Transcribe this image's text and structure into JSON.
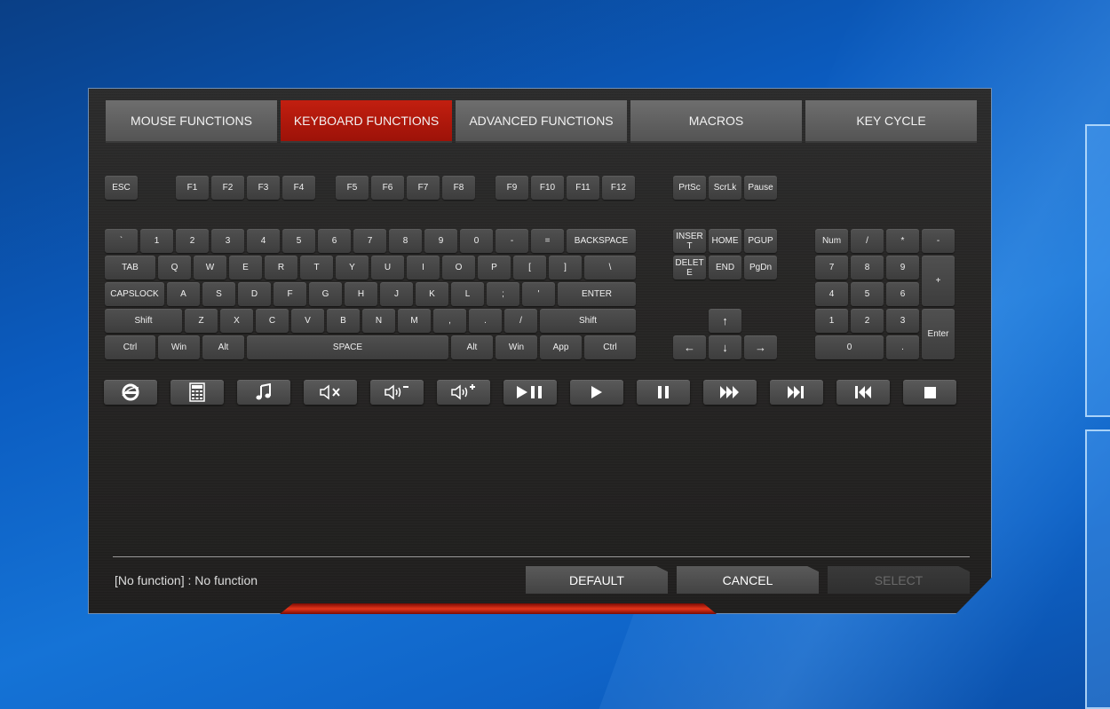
{
  "tabs": [
    {
      "label": "MOUSE FUNCTIONS",
      "active": false
    },
    {
      "label": "KEYBOARD FUNCTIONS",
      "active": true
    },
    {
      "label": "ADVANCED FUNCTIONS",
      "active": false
    },
    {
      "label": "MACROS",
      "active": false
    },
    {
      "label": "KEY CYCLE",
      "active": false
    }
  ],
  "keys": {
    "esc": "ESC",
    "f1": "F1",
    "f2": "F2",
    "f3": "F3",
    "f4": "F4",
    "f5": "F5",
    "f6": "F6",
    "f7": "F7",
    "f8": "F8",
    "f9": "F9",
    "f10": "F10",
    "f11": "F11",
    "f12": "F12",
    "prtsc": "PrtSc",
    "scrlk": "ScrLk",
    "pause": "Pause",
    "grave": "`",
    "d1": "1",
    "d2": "2",
    "d3": "3",
    "d4": "4",
    "d5": "5",
    "d6": "6",
    "d7": "7",
    "d8": "8",
    "d9": "9",
    "d0": "0",
    "minus": "-",
    "equal": "=",
    "backspace": "BACKSPACE",
    "tab": "TAB",
    "q": "Q",
    "w": "W",
    "e": "E",
    "r": "R",
    "t": "T",
    "y": "Y",
    "u": "U",
    "i": "I",
    "o": "O",
    "p": "P",
    "lbracket": "[",
    "rbracket": "]",
    "backslash": "\\",
    "capslock": "CAPSLOCK",
    "a": "A",
    "s": "S",
    "d": "D",
    "f": "F",
    "g": "G",
    "h": "H",
    "j": "J",
    "k": "K",
    "l": "L",
    "semicolon": ";",
    "quote": "'",
    "enter": "ENTER",
    "lshift": "Shift",
    "z": "Z",
    "x": "X",
    "c": "C",
    "v": "V",
    "b": "B",
    "n": "N",
    "m": "M",
    "comma": ",",
    "period": ".",
    "slash": "/",
    "rshift": "Shift",
    "lctrl": "Ctrl",
    "lwin": "Win",
    "lalt": "Alt",
    "space": "SPACE",
    "ralt": "Alt",
    "rwin": "Win",
    "app": "App",
    "rctrl": "Ctrl",
    "insert": "INSERT",
    "home": "HOME",
    "pgup": "PGUP",
    "delete": "DELETE",
    "end": "END",
    "pgdn": "PgDn",
    "up": "↑",
    "left": "←",
    "down": "↓",
    "right": "→",
    "num": "Num",
    "np_div": "/",
    "np_mul": "*",
    "np_sub": "-",
    "np7": "7",
    "np8": "8",
    "np9": "9",
    "np_add": "+",
    "np4": "4",
    "np5": "5",
    "np6": "6",
    "np1": "1",
    "np2": "2",
    "np3": "3",
    "np_enter": "Enter",
    "np0": "0",
    "np_dot": "."
  },
  "media_icons": [
    "browser-icon",
    "calculator-icon",
    "music-icon",
    "mute-icon",
    "volume-down-icon",
    "volume-up-icon",
    "play-pause-icon",
    "play-icon",
    "pause-icon",
    "fast-forward-icon",
    "next-track-icon",
    "previous-track-icon",
    "stop-icon"
  ],
  "status_text": "[No function] : No function",
  "buttons": {
    "default": "DEFAULT",
    "cancel": "CANCEL",
    "select": "SELECT"
  },
  "colors": {
    "accent": "#c21f10",
    "key": "#474747",
    "panel": "#262524"
  }
}
